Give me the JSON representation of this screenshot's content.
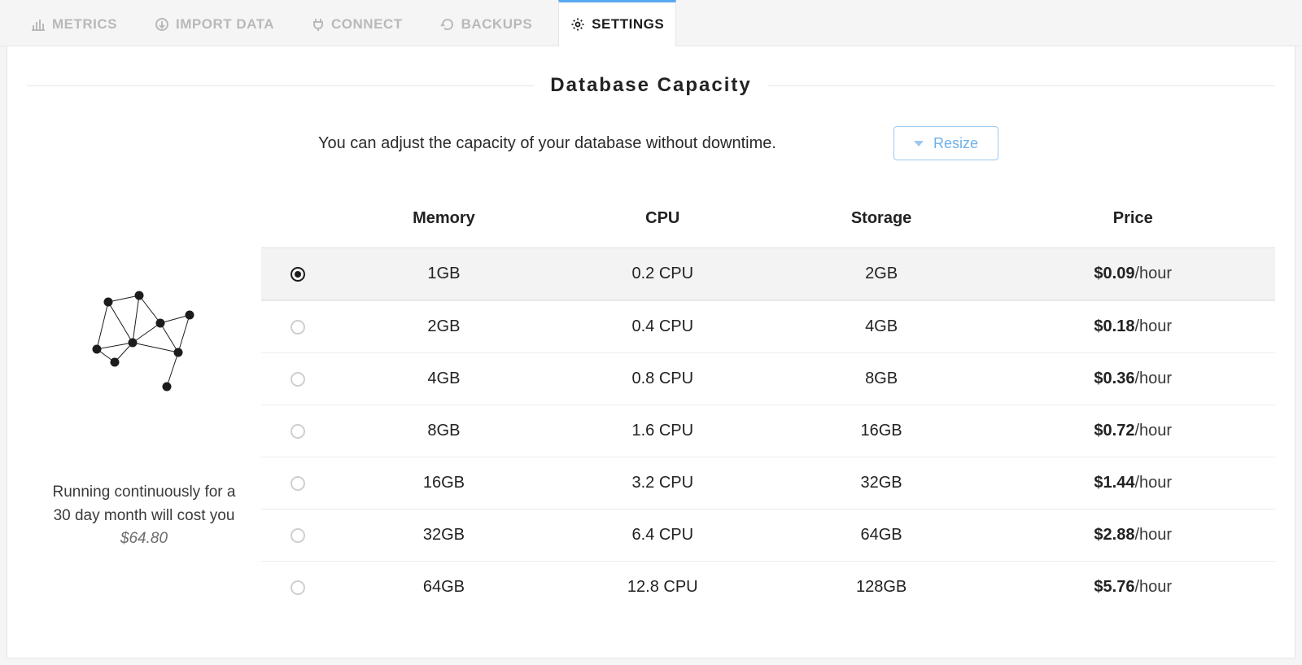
{
  "tabs": [
    {
      "label": "METRICS",
      "icon": "metrics-icon"
    },
    {
      "label": "IMPORT DATA",
      "icon": "import-icon"
    },
    {
      "label": "CONNECT",
      "icon": "connect-icon"
    },
    {
      "label": "BACKUPS",
      "icon": "backups-icon"
    },
    {
      "label": "SETTINGS",
      "icon": "settings-icon"
    }
  ],
  "active_tab": 4,
  "section_title": "Database Capacity",
  "description": "You can adjust the capacity of your database without downtime.",
  "resize_label": "Resize",
  "sidebar_caption_line1": "Running continuously for a",
  "sidebar_caption_line2": "30 day month will cost you",
  "sidebar_cost": "$64.80",
  "columns": {
    "memory": "Memory",
    "cpu": "CPU",
    "storage": "Storage",
    "price": "Price"
  },
  "price_suffix": "/hour",
  "selected_tier": 0,
  "tiers": [
    {
      "memory": "1GB",
      "cpu": "0.2 CPU",
      "storage": "2GB",
      "price": "$0.09"
    },
    {
      "memory": "2GB",
      "cpu": "0.4 CPU",
      "storage": "4GB",
      "price": "$0.18"
    },
    {
      "memory": "4GB",
      "cpu": "0.8 CPU",
      "storage": "8GB",
      "price": "$0.36"
    },
    {
      "memory": "8GB",
      "cpu": "1.6 CPU",
      "storage": "16GB",
      "price": "$0.72"
    },
    {
      "memory": "16GB",
      "cpu": "3.2 CPU",
      "storage": "32GB",
      "price": "$1.44"
    },
    {
      "memory": "32GB",
      "cpu": "6.4 CPU",
      "storage": "64GB",
      "price": "$2.88"
    },
    {
      "memory": "64GB",
      "cpu": "12.8 CPU",
      "storage": "128GB",
      "price": "$5.76"
    }
  ]
}
